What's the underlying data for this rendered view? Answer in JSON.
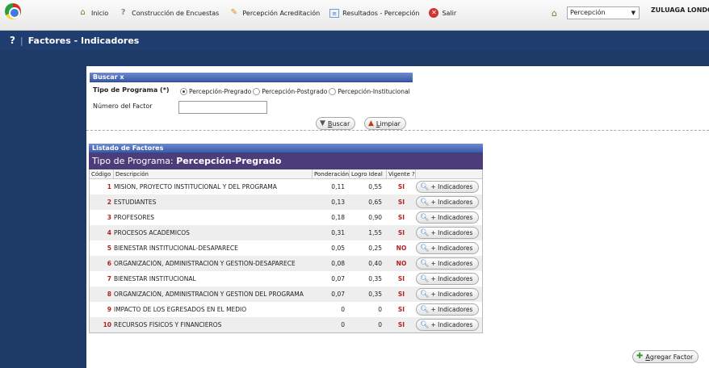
{
  "menu": {
    "items": [
      {
        "name": "menu-inicio",
        "icon": "home-icon",
        "glyph": "⌂",
        "label": "Inicio"
      },
      {
        "name": "menu-construccion",
        "icon": "help-icon",
        "glyph": "?",
        "label": "Construcción de Encuestas"
      },
      {
        "name": "menu-percepcion-acreditacion",
        "icon": "pen-icon",
        "glyph": "✎",
        "label": "Percepción Acreditación"
      },
      {
        "name": "menu-resultados",
        "icon": "results-icon",
        "glyph": "≡",
        "label": "Resultados - Percepción"
      },
      {
        "name": "menu-salir",
        "icon": "exit-icon",
        "glyph": "✕",
        "label": "Salir"
      }
    ]
  },
  "profile": {
    "selected": "Percepción",
    "user": "ZULUAGA LONDOÑ"
  },
  "title": {
    "help": "?",
    "sep": "|",
    "text": "Factores - Indicadores"
  },
  "search": {
    "header": "Buscar x",
    "program_label": "Tipo de Programa (*)",
    "program_options": [
      "Percepción-Pregrado",
      "Percepción-Postgrado",
      "Percepción-Institucional"
    ],
    "selected_program": 0,
    "factor_label": "Número del Factor",
    "factor_value": "",
    "search_button": {
      "prefix": "",
      "underlined": "B",
      "rest": "uscar"
    },
    "clear_button": {
      "prefix": "",
      "underlined": "L",
      "rest": "impiar"
    }
  },
  "list": {
    "header": "Listado de Factores",
    "program_prefix": "Tipo de Programa: ",
    "program_name": "Percepción-Pregrado",
    "columns": [
      "Código",
      "Descripción",
      "Ponderación",
      "Logro Ideal",
      "Vigente ?"
    ],
    "button_label": "+ Indicadores",
    "rows": [
      {
        "code": "1",
        "desc": "MISION, PROYECTO INSTITUCIONAL Y DEL PROGRAMA",
        "pond": "0,11",
        "logro": "0,55",
        "vig": "SI"
      },
      {
        "code": "2",
        "desc": "ESTUDIANTES",
        "pond": "0,13",
        "logro": "0,65",
        "vig": "SI"
      },
      {
        "code": "3",
        "desc": "PROFESORES",
        "pond": "0,18",
        "logro": "0,90",
        "vig": "SI"
      },
      {
        "code": "4",
        "desc": "PROCESOS ACADÉMICOS",
        "pond": "0,31",
        "logro": "1,55",
        "vig": "SI"
      },
      {
        "code": "5",
        "desc": "BIENESTAR INSTITUCIONAL-DESAPARECE",
        "pond": "0,05",
        "logro": "0,25",
        "vig": "NO"
      },
      {
        "code": "6",
        "desc": "ORGANIZACIÓN, ADMINISTRACIÓN Y GESTIÓN-DESAPARECE",
        "pond": "0,08",
        "logro": "0,40",
        "vig": "NO"
      },
      {
        "code": "7",
        "desc": "BIENESTAR INSTITUCIONAL",
        "pond": "0,07",
        "logro": "0,35",
        "vig": "SI"
      },
      {
        "code": "8",
        "desc": "ORGANIZACIÓN, ADMINISTRACIÓN Y GESTIÓN DEL PROGRAMA",
        "pond": "0,07",
        "logro": "0,35",
        "vig": "SI"
      },
      {
        "code": "9",
        "desc": "IMPACTO DE LOS EGRESADOS EN EL MEDIO",
        "pond": "0",
        "logro": "0",
        "vig": "SI"
      },
      {
        "code": "10",
        "desc": "RECURSOS FÍSICOS Y FINANCIEROS",
        "pond": "0",
        "logro": "0",
        "vig": "SI"
      }
    ]
  },
  "add_button": {
    "prefix": "",
    "underlined": "A",
    "rest": "gregar Factor"
  }
}
